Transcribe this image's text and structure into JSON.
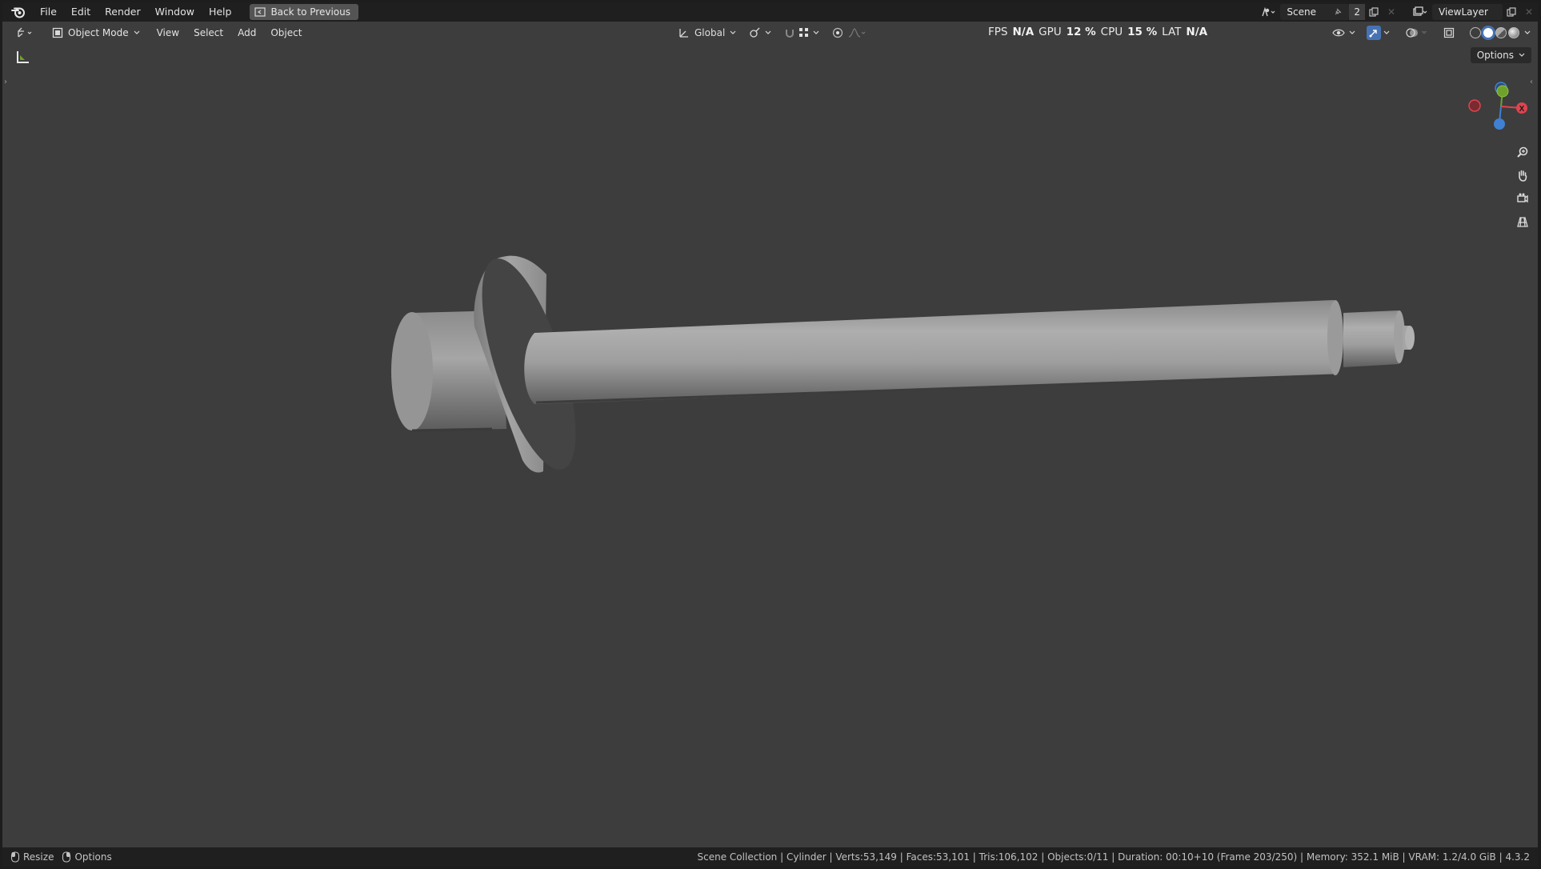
{
  "menu": {
    "items": [
      "File",
      "Edit",
      "Render",
      "Window",
      "Help"
    ],
    "back_label": "Back to Previous"
  },
  "top_right": {
    "scene_name": "Scene",
    "scene_users": "2",
    "view_layer": "ViewLayer"
  },
  "viewport_header": {
    "mode": "Object Mode",
    "menus": [
      "View",
      "Select",
      "Add",
      "Object"
    ],
    "transform_orientation": "Global"
  },
  "performance": {
    "fps_label": "FPS",
    "fps_value": "N/A",
    "gpu_label": "GPU",
    "gpu_value": "12 %",
    "cpu_label": "CPU",
    "cpu_value": "15 %",
    "lat_label": "LAT",
    "lat_value": "N/A"
  },
  "overlay": {
    "options_label": "Options"
  },
  "gizmo": {
    "x_label": "X"
  },
  "status": {
    "resize_label": "Resize",
    "options_label": "Options",
    "info": "Scene Collection | Cylinder | Verts:53,149 | Faces:53,101 | Tris:106,102 | Objects:0/11 | Duration: 00:10+10 (Frame 203/250) | Memory: 352.1 MiB | VRAM: 1.2/4.0 GiB | 4.3.2"
  },
  "colors": {
    "viewport_bg": "#3d3d3d",
    "header_bg": "#1f1f1f",
    "axis_x": "#e0434f",
    "axis_y": "#6ea22a",
    "axis_z": "#3f80d3",
    "active_blue": "#4772b3"
  }
}
